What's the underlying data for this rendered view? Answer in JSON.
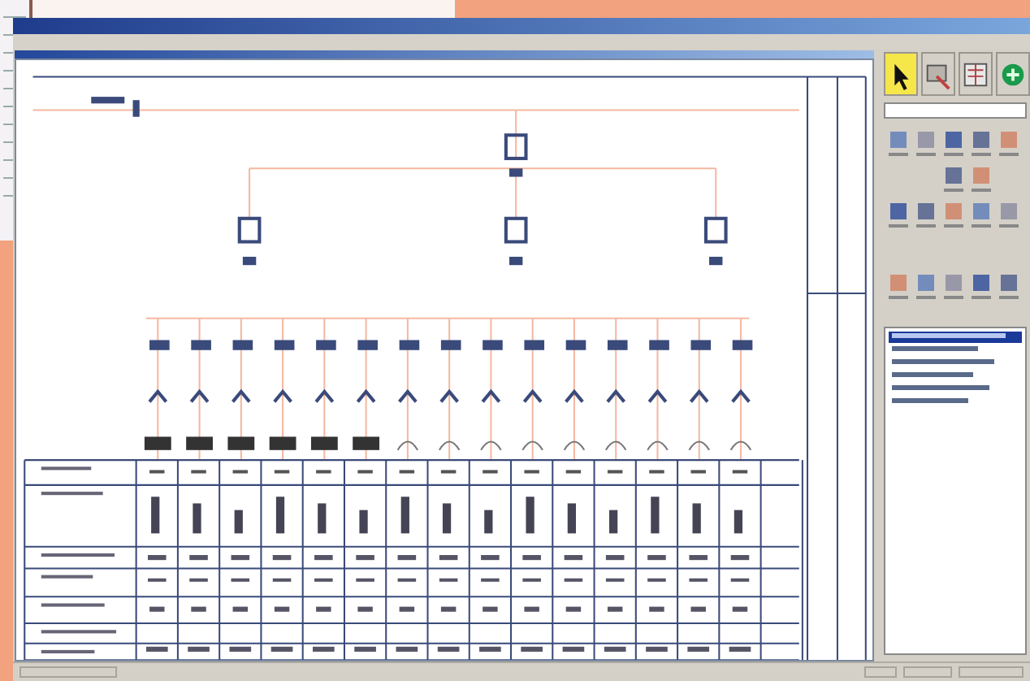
{
  "toolbar": {
    "buttons": [
      {
        "selected": true
      },
      {
        "selected": false
      },
      {
        "selected": false
      },
      {
        "selected": false
      }
    ]
  },
  "component_list": {
    "items": [
      {
        "selected": true
      },
      {
        "selected": false
      },
      {
        "selected": false
      },
      {
        "selected": false
      },
      {
        "selected": false
      },
      {
        "selected": false
      }
    ]
  }
}
